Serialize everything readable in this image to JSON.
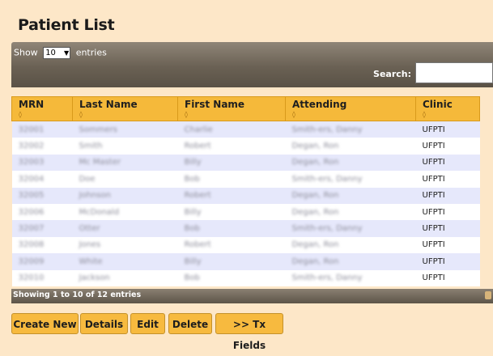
{
  "page": {
    "title": "Patient List"
  },
  "controls": {
    "show_label": "Show",
    "entries_value": "10",
    "entries_label": "entries",
    "search_label": "Search:",
    "search_value": ""
  },
  "table": {
    "columns": [
      "MRN",
      "Last Name",
      "First Name",
      "Attending",
      "Clinic"
    ],
    "rows": [
      {
        "mrn": "32001",
        "last": "Sommers",
        "first": "Charlie",
        "attending": "Smith-ers, Danny",
        "clinic": "UFPTI"
      },
      {
        "mrn": "32002",
        "last": "Smith",
        "first": "Robert",
        "attending": "Degan, Ron",
        "clinic": "UFPTI"
      },
      {
        "mrn": "32003",
        "last": "Mc Master",
        "first": "Billy",
        "attending": "Degan, Ron",
        "clinic": "UFPTI"
      },
      {
        "mrn": "32004",
        "last": "Doe",
        "first": "Bob",
        "attending": "Smith-ers, Danny",
        "clinic": "UFPTI"
      },
      {
        "mrn": "32005",
        "last": "Johnson",
        "first": "Robert",
        "attending": "Degan, Ron",
        "clinic": "UFPTI"
      },
      {
        "mrn": "32006",
        "last": "McDonald",
        "first": "Billy",
        "attending": "Degan, Ron",
        "clinic": "UFPTI"
      },
      {
        "mrn": "32007",
        "last": "Otter",
        "first": "Bob",
        "attending": "Smith-ers, Danny",
        "clinic": "UFPTI"
      },
      {
        "mrn": "32008",
        "last": "Jones",
        "first": "Robert",
        "attending": "Degan, Ron",
        "clinic": "UFPTI"
      },
      {
        "mrn": "32009",
        "last": "White",
        "first": "Billy",
        "attending": "Degan, Ron",
        "clinic": "UFPTI"
      },
      {
        "mrn": "32010",
        "last": "Jackson",
        "first": "Bob",
        "attending": "Smith-ers, Danny",
        "clinic": "UFPTI"
      }
    ],
    "info": "Showing 1 to 10 of 12 entries"
  },
  "buttons": {
    "create_new": "Create New",
    "details": "Details",
    "edit": "Edit",
    "delete": "Delete",
    "tx_fields": ">> Tx Fields"
  },
  "colors": {
    "background": "#fde7c8",
    "header_accent": "#f5b93a",
    "row_alt": "#e6e8fb",
    "toolbar": "#6a6154"
  }
}
